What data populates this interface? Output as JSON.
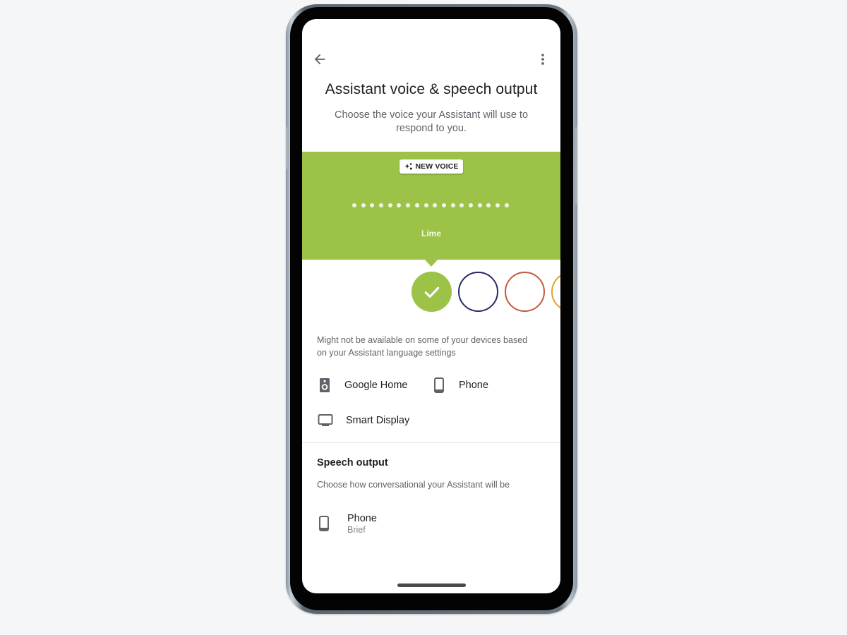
{
  "header": {
    "back_icon": "arrow-back-icon",
    "more_icon": "more-vert-icon",
    "title": "Assistant voice & speech output",
    "subtitle": "Choose the voice your Assistant will use to respond to you."
  },
  "voice_panel": {
    "badge_icon": "sparkle-icon",
    "badge_label": "NEW VOICE",
    "selected_voice": "Lime",
    "panel_color": "#9cc348",
    "waveform_dot_count": 18
  },
  "voice_swatches": [
    {
      "name": "Lime",
      "color": "#9cc348",
      "selected": true
    },
    {
      "name": "voice-2",
      "color": "#2a2a66",
      "selected": false
    },
    {
      "name": "voice-3",
      "color": "#c45a3f",
      "selected": false
    },
    {
      "name": "voice-4",
      "color": "#e0a030",
      "selected": false
    }
  ],
  "availability": {
    "note": "Might not be available on some of your devices based on your Assistant language settings",
    "devices": [
      {
        "label": "Google Home",
        "icon": "speaker-icon"
      },
      {
        "label": "Phone",
        "icon": "phone-icon"
      },
      {
        "label": "Smart Display",
        "icon": "display-icon"
      }
    ]
  },
  "speech_output": {
    "title": "Speech output",
    "subtitle": "Choose how conversational your Assistant will be",
    "items": [
      {
        "label": "Phone",
        "value": "Brief",
        "icon": "phone-icon"
      }
    ]
  }
}
